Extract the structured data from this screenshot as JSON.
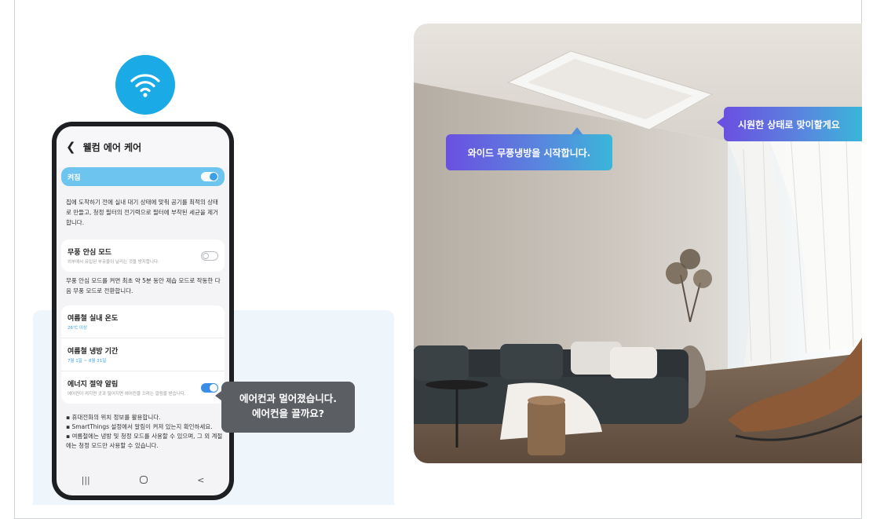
{
  "app": {
    "title": "웰컴 에어 케어",
    "back_icon": "chevron-left-icon",
    "main_switch": {
      "label": "켜짐",
      "on": true
    },
    "description": "집에 도착하기 전에 실내 대기 상태에 맞춰 공기를 최적의 상태로 만들고, 청정 필터의 전기력으로 필터에 부착된 세균을 제거합니다.",
    "windfree_mode": {
      "title": "무풍 안심 모드",
      "subtitle": "외부에서 유입된 부유물이 날리는 것을 방지합니다.",
      "on": false
    },
    "windfree_description": "무풍 안심 모드를 켜면 최초 약 5분 동안 제습 모드로 작동한 다음 무풍 모드로 전환합니다.",
    "settings": [
      {
        "title": "여름철 실내 온도",
        "value": "26℃ 이상"
      },
      {
        "title": "여름철 냉방 기간",
        "value": "7월 1일 ~ 8월 31일"
      }
    ],
    "energy_alert": {
      "title": "에너지 절약 알림",
      "subtitle": "에어컨이 켜지면 곳과 떨어지면 에어컨을 끄라는 알림을 받습니다.",
      "on": true
    },
    "notes": [
      "▪ 휴대전화의 위치 정보를 활용합니다.",
      "▪ SmartThings 설정에서 알림이 켜져 있는지 확인하세요.",
      "▪ 여름철에는 냉방 및 청정 모드를 사용할 수 있으며, 그 외 계절에는 청정 모드만 사용할 수 있습니다."
    ],
    "nav": {
      "recent": "|||",
      "home": "home-icon",
      "back": "<"
    }
  },
  "bubbles": {
    "phone_line1": "에어컨과 멀어졌습니다.",
    "phone_line2": "에어컨을 끌까요?",
    "wide_cooling": "와이드 무풍냉방을 시작합니다.",
    "welcome_cool": "시원한 상태로 맞이할게요"
  },
  "colors": {
    "wifi_blue": "#1aaae6",
    "switch_bar": "#6cc4ef",
    "bubble_gradient_start": "#6a50e0",
    "bubble_gradient_end": "#3ab6d9",
    "dark_bubble": "#5b5e63"
  }
}
